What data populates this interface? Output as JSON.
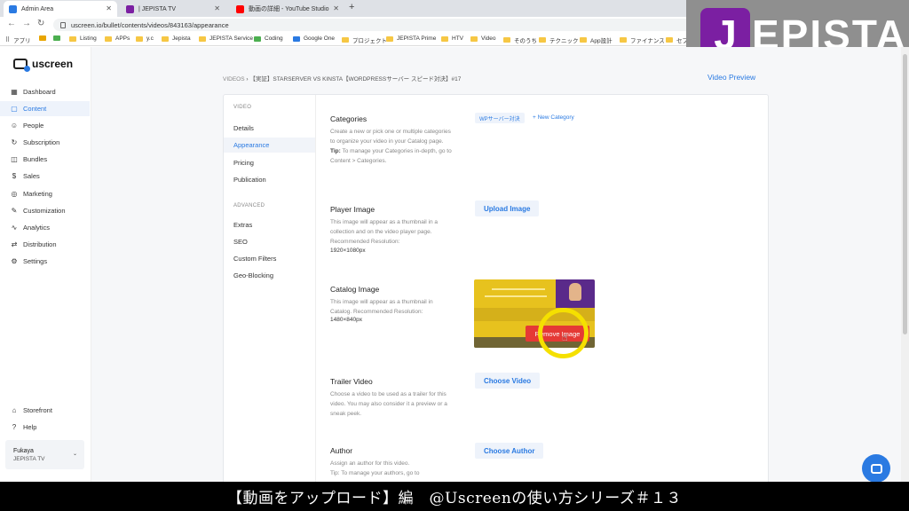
{
  "browser": {
    "tabs": [
      {
        "title": "Admin Area",
        "favicon_color": "#2a7ae2",
        "active": true
      },
      {
        "title": "| JEPISTA TV",
        "favicon_color": "#7b1fa2",
        "active": false
      },
      {
        "title": "動画の詳細 - YouTube Studio",
        "favicon_color": "#ff0000",
        "active": false
      }
    ],
    "new_tab": "+",
    "url": "uscreen.io/bullet/contents/videos/843163/appearance",
    "bookmarks": [
      "アプリ",
      "Listing",
      "APPs",
      "y.c",
      "Jepista",
      "JEPISTA Service",
      "Coding",
      "Google One",
      "プロジェクト",
      "JEPISTA Prime",
      "HTV",
      "Video",
      "そのうち",
      "テクニック",
      "App設計",
      "ファイナンス",
      "セプ"
    ]
  },
  "logo": {
    "mark": "J",
    "text": "EPISTA"
  },
  "app": {
    "brand": "uscreen",
    "nav": [
      {
        "label": "Dashboard",
        "icon": "▦"
      },
      {
        "label": "Content",
        "icon": "▢",
        "active": true
      },
      {
        "label": "People",
        "icon": "☺"
      },
      {
        "label": "Subscription",
        "icon": "↻"
      },
      {
        "label": "Bundles",
        "icon": "◫"
      },
      {
        "label": "Sales",
        "icon": "$"
      },
      {
        "label": "Marketing",
        "icon": "◎"
      },
      {
        "label": "Customization",
        "icon": "✎"
      },
      {
        "label": "Analytics",
        "icon": "∿"
      },
      {
        "label": "Distribution",
        "icon": "⇄"
      },
      {
        "label": "Settings",
        "icon": "⚙"
      }
    ],
    "bottom_nav": [
      {
        "label": "Storefront",
        "icon": "⌂"
      },
      {
        "label": "Help",
        "icon": "?"
      }
    ],
    "user": {
      "name": "Fukaya",
      "site": "JEPISTA TV",
      "chevron": "⌄"
    }
  },
  "breadcrumb": {
    "root": "VIDEOS",
    "sep": "›",
    "title": "【実証】STARSERVER VS KINSTA【WORDPRESSサーバー スピード対決】#17"
  },
  "video_preview": "Video Preview",
  "content_nav": {
    "video_header": "VIDEO",
    "video_items": [
      "Details",
      "Appearance",
      "Pricing",
      "Publication"
    ],
    "advanced_header": "ADVANCED",
    "advanced_items": [
      "Extras",
      "SEO",
      "Custom Filters",
      "Geo-Blocking"
    ]
  },
  "fields": {
    "categories": {
      "title": "Categories",
      "desc": "Create a new or pick one or multiple categories to organize your video in your Catalog page.",
      "tip_label": "Tip:",
      "tip": "To manage your Categories in-depth, go to Content > Categories.",
      "tag": "WPサーバー対決",
      "new_category": "+ New Category"
    },
    "player_image": {
      "title": "Player Image",
      "desc": "This image will appear as a thumbnail in a collection and on the video player page. Recommended Resolution:",
      "resolution": "1920×1080px",
      "button": "Upload Image"
    },
    "catalog_image": {
      "title": "Catalog Image",
      "desc": "This image will appear as a thumbnail in Catalog. Recommended Resolution:",
      "resolution": "1480×840px",
      "remove_button": "Remove Image"
    },
    "trailer_video": {
      "title": "Trailer Video",
      "desc": "Choose a video to be used as a trailer for this video. You may also consider it a preview or a sneak peek.",
      "button": "Choose Video"
    },
    "author": {
      "title": "Author",
      "desc": "Assign an author for this video.",
      "tip": "Tip: To manage your authors, go to",
      "button": "Choose Author"
    }
  },
  "caption": "【動画をアップロード】編　@Uscreenの使い方シリーズ＃１３",
  "colors": {
    "accent": "#2a7ae2",
    "remove": "#e53935",
    "highlight_ring": "#f5e000",
    "logo_purple": "#7b1fa2"
  }
}
